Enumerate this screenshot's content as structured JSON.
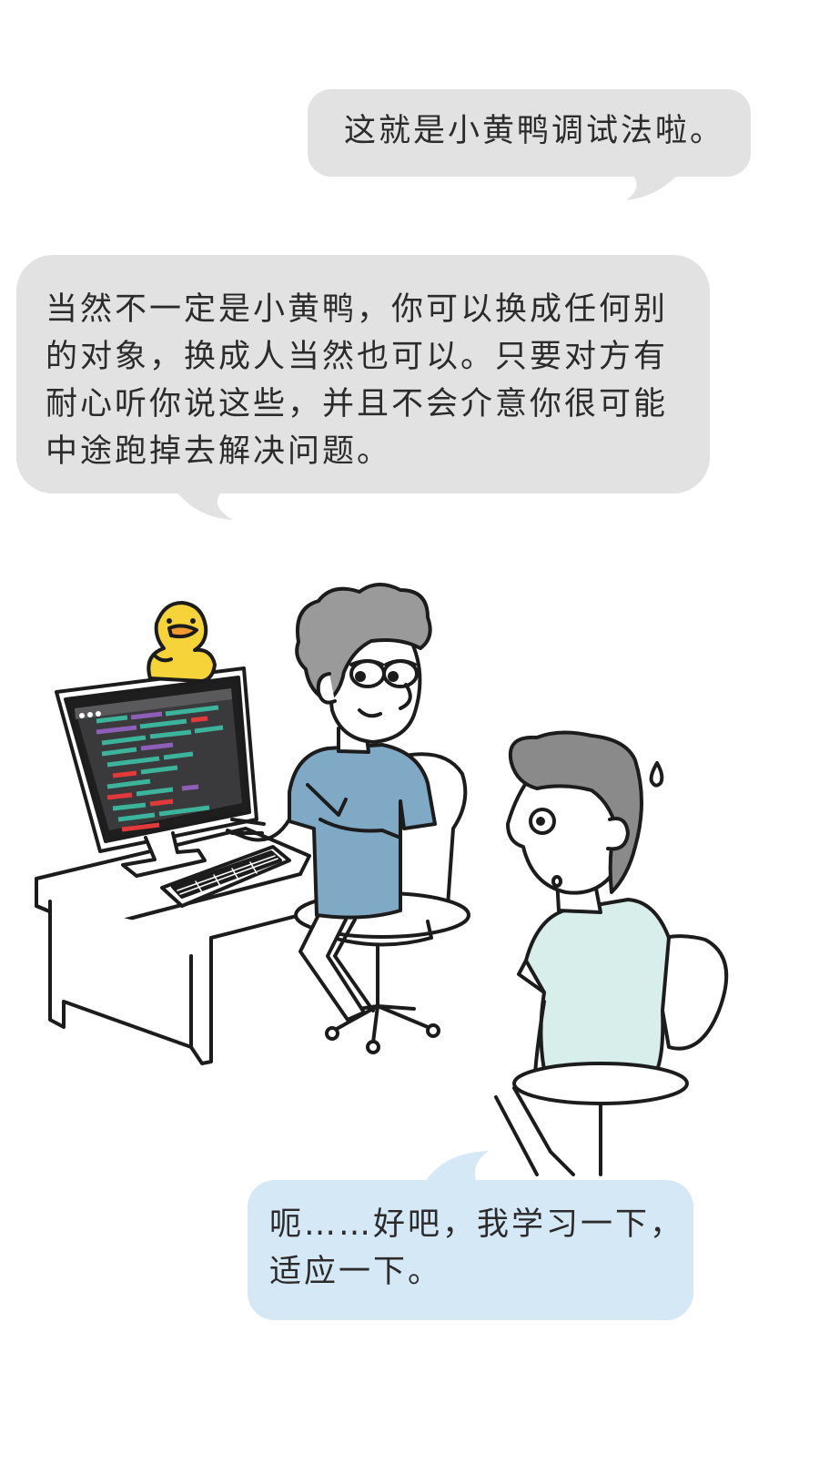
{
  "bubbles": {
    "top": "这就是小黄鸭调试法啦。",
    "middle": "当然不一定是小黄鸭，你可以换成任何别的对象，换成人当然也可以。只要对方有耐心听你说这些，并且不会介意你很可能中途跑掉去解决问题。",
    "bottom": "呃……好吧，我学习一下，适应一下。"
  },
  "colors": {
    "gray_bubble": "#e2e2e2",
    "blue_bubble": "#d5e8f6",
    "shirt_blue": "#7fa9c5",
    "shirt_mint": "#d7eeea",
    "hair_gray": "#9a9a9a",
    "duck_yellow": "#f7d33a",
    "monitor_screen": "#3a3a3c",
    "code_green": "#3cb39b",
    "code_purple": "#8e5fb7",
    "code_red": "#e23a3a"
  },
  "icons": {
    "duck": "rubber-duck-icon",
    "sweat": "sweat-drop-icon"
  }
}
